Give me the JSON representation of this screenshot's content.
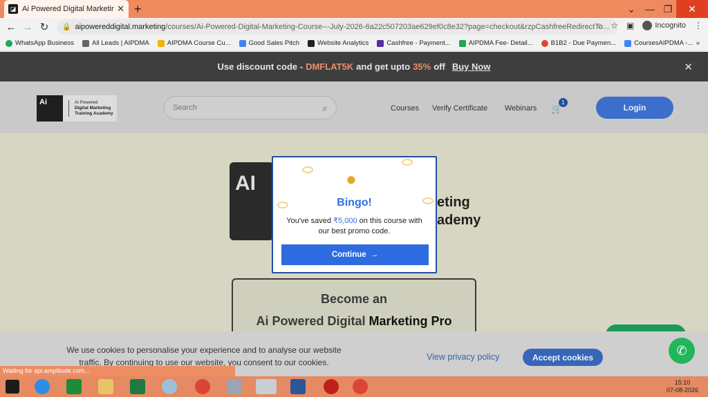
{
  "browser": {
    "tab_title": "Ai Powered Digital Marketing Co",
    "url_host": "aipowereddigital.marketing",
    "url_path": "/courses/Ai-Powered-Digital-Marketing-Course---July-2026-6a22c507203ae629ef0c8e32?page=checkout&rzpCashfreeRedirectTo...",
    "incognito_label": "Incognito",
    "bookmarks": [
      {
        "label": "WhatsApp Business",
        "color": "#1fa855"
      },
      {
        "label": "All Leads | AIPDMA",
        "color": "#666666"
      },
      {
        "label": "AIPDMA Course Cu...",
        "color": "#f4b400"
      },
      {
        "label": "Good Sales Pitch",
        "color": "#4285f4"
      },
      {
        "label": "Website Analytics",
        "color": "#222222"
      },
      {
        "label": "Cashfree - Payment...",
        "color": "#5a2ca0"
      },
      {
        "label": "AIPDMA Fee- Detail...",
        "color": "#1fa855"
      },
      {
        "label": "B1B2 - Due Paymen...",
        "color": "#db4437"
      },
      {
        "label": "CoursesAIPDMA -...",
        "color": "#4285f4"
      }
    ],
    "status_text": "Waiting for api.amplitude.com..."
  },
  "promo": {
    "prefix": "Use discount code -",
    "code": "DMFLAT5K",
    "middle": "and get upto",
    "percent": "35%",
    "suffix": "off",
    "buy_now": "Buy Now"
  },
  "header": {
    "logo_mark": "Ai",
    "logo_line1": "Ai Powered",
    "logo_line2": "Digital Marketing",
    "logo_line3": "Training Academy",
    "search_placeholder": "Search",
    "nav": [
      "Courses",
      "Verify Certificate",
      "Webinars"
    ],
    "cart_count": "1",
    "login": "Login"
  },
  "hero": {
    "logo_mark": "AI",
    "text_line1": "eting",
    "text_line2": "ademy",
    "card_line1": "Become an",
    "card_line2a": "Ai Powered Digital",
    "card_line2b": "Marketing Pro"
  },
  "modal": {
    "title": "Bingo!",
    "saved_prefix": "You've saved",
    "amount": "₹5,000",
    "saved_suffix": "on this course with our best promo code.",
    "continue": "Continue"
  },
  "cookies": {
    "text": "We use cookies to personalise your experience and to analyse our website traffic. By continuing to use our website, you consent to our cookies.",
    "privacy": "View privacy policy",
    "accept": "Accept cookies"
  },
  "taskbar": {
    "time": "15:10",
    "date": "07-08-2026"
  }
}
